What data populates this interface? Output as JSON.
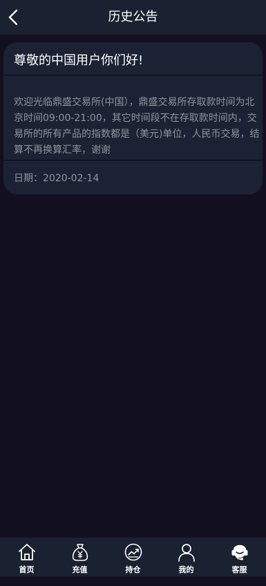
{
  "header": {
    "title": "历史公告",
    "back_icon": "chevron-left-icon"
  },
  "notice": {
    "title": "尊敬的中国用户你们好!",
    "body": "欢迎光临鼎盛交易所(中国），鼎盛交易所存取款时间为北京时间09:00-21:00，其它时间段不在存取款时间内，交易所的所有产品的指数都是（美元)单位，人民币交易，结算不再换算汇率，谢谢",
    "date": "日期：2020-02-14"
  },
  "tabbar": {
    "items": [
      {
        "label": "首页",
        "icon": "home-icon"
      },
      {
        "label": "充值",
        "icon": "money-bag-icon"
      },
      {
        "label": "持仓",
        "icon": "trend-chart-icon"
      },
      {
        "label": "我的",
        "icon": "user-icon"
      },
      {
        "label": "客服",
        "icon": "headset-icon"
      }
    ]
  },
  "colors": {
    "background": "#121020",
    "bar": "#1a2130",
    "card": "#1b2233",
    "muted_text": "#8f949e"
  }
}
